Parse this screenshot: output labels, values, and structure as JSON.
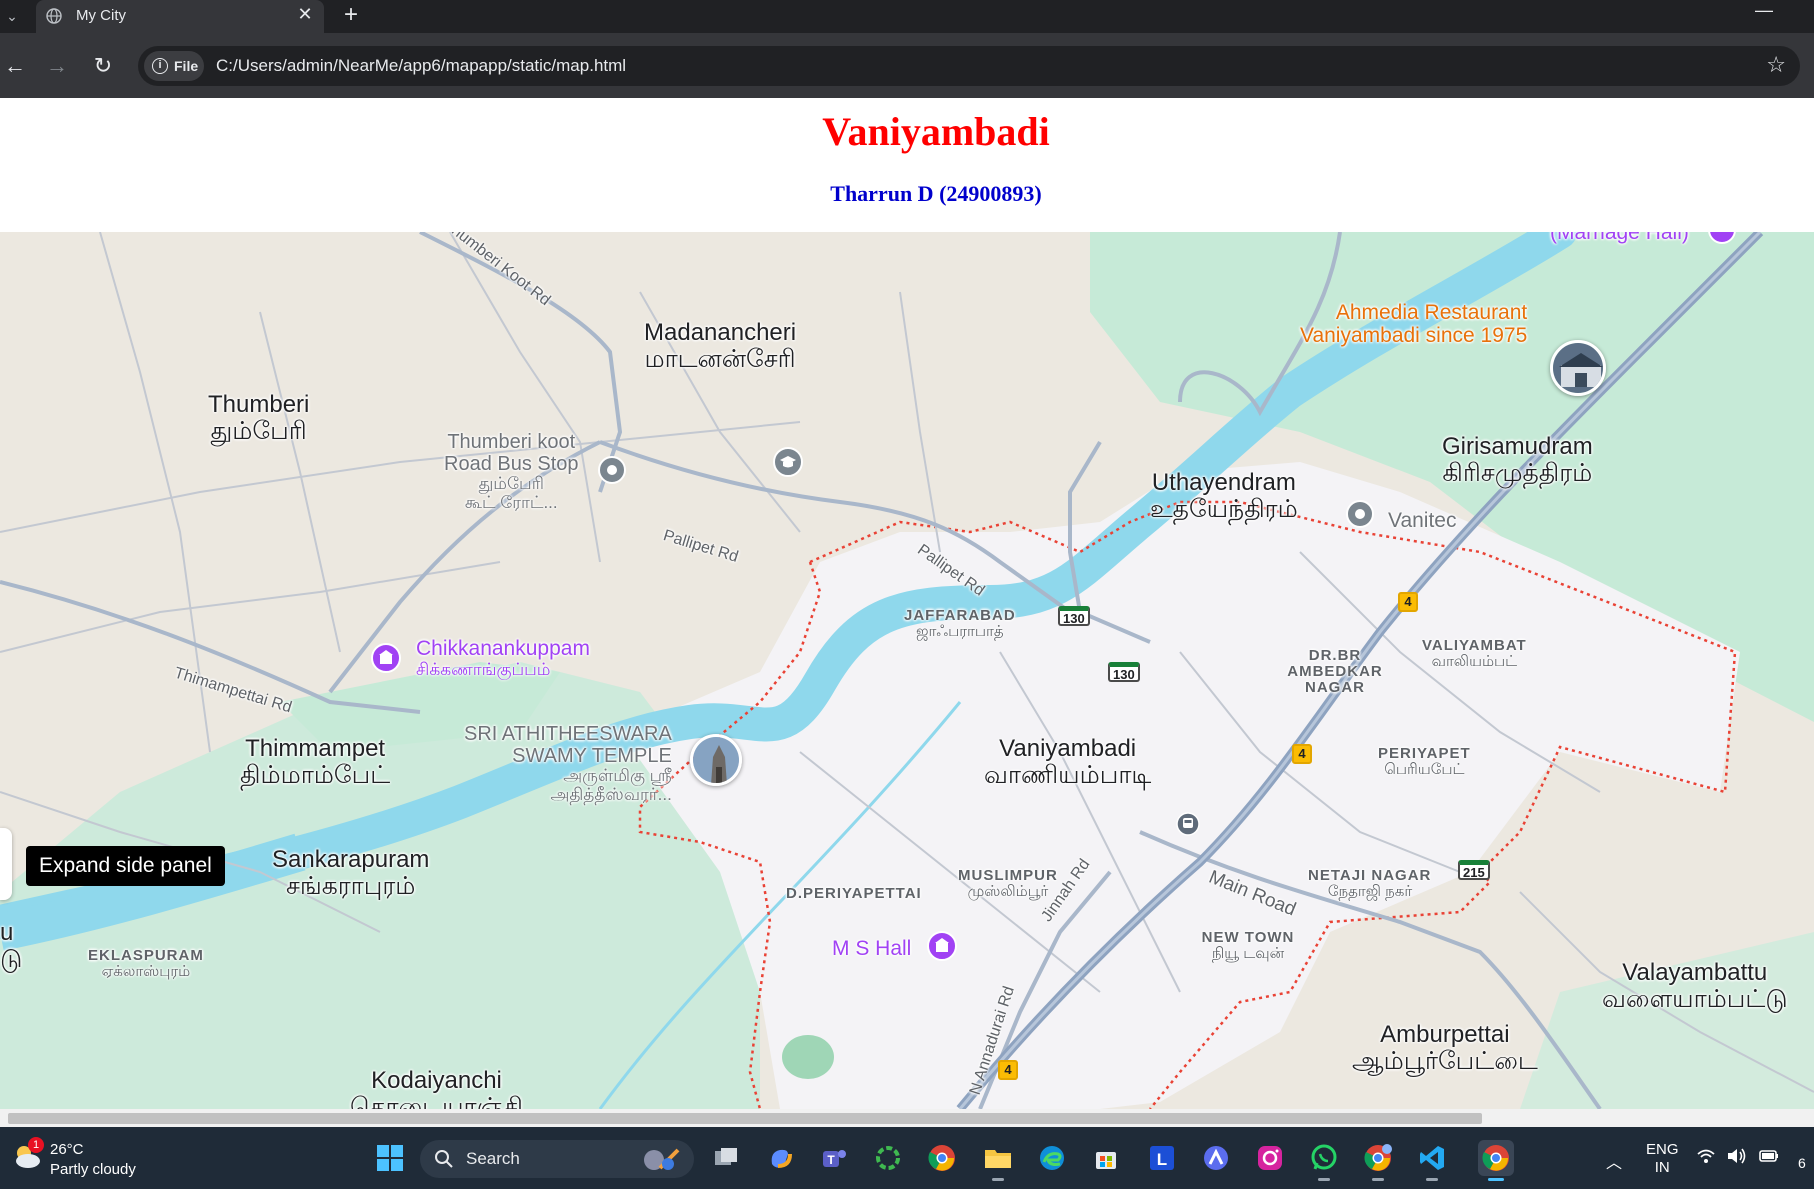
{
  "browser": {
    "tab_title": "My City",
    "new_tab": "+",
    "close_tab": "✕",
    "minimize": "—",
    "chip_label": "File",
    "url": "C:/Users/admin/NearMe/app6/mapapp/static/map.html"
  },
  "page": {
    "title": "Vaniyambadi",
    "subtitle": "Tharrun D (24900893)"
  },
  "map": {
    "towns": {
      "madanancheri": {
        "en": "Madanancheri",
        "ta": "மாடனன்சேரி"
      },
      "thumberi": {
        "en": "Thumberi",
        "ta": "தும்பேரி"
      },
      "uthayendram": {
        "en": "Uthayendram",
        "ta": "உதயேந்திரம்"
      },
      "girisamudram": {
        "en": "Girisamudram",
        "ta": "கிரிசமுத்திரம்"
      },
      "thimmampet": {
        "en": "Thimmampet",
        "ta": "திம்மாம்பேட்"
      },
      "vaniyambadi": {
        "en": "Vaniyambadi",
        "ta": "வாணியம்பாடி"
      },
      "sankarapuram": {
        "en": "Sankarapuram",
        "ta": "சங்கராபுரம்"
      },
      "valayambattu": {
        "en": "Valayambattu",
        "ta": "வளையாம்பட்டு"
      },
      "amburpettai": {
        "en": "Amburpettai",
        "ta": "ஆம்பூர்பேட்டை"
      },
      "kodaiyanchi": {
        "en": "Kodaiyanchi",
        "ta": "கொடையாஞ்சி"
      },
      "edge_left": {
        "en": "u",
        "ta": "டு"
      }
    },
    "neighbourhoods": {
      "jaffarabad": {
        "en": "JAFFARABAD",
        "ta": "ஜாஃபராபாத்"
      },
      "drbr": {
        "en": "DR.BR AMBEDKAR NAGAR"
      },
      "valiyambat": {
        "en": "VALIYAMBAT",
        "ta": "வாலியம்பட்"
      },
      "periyapet": {
        "en": "PERIYAPET",
        "ta": "பெரியபேட்"
      },
      "netaji": {
        "en": "NETAJI NAGAR",
        "ta": "நேதாஜி நகர்"
      },
      "newtown": {
        "en": "NEW TOWN",
        "ta": "நியூ டவுன்"
      },
      "muslimpur": {
        "en": "MUSLIMPUR",
        "ta": "முஸ்லிம்பூர்"
      },
      "dperiyapettai": {
        "en": "D.PERIYAPETTAI"
      },
      "eklaspuram": {
        "en": "EKLASPURAM",
        "ta": "ஏக்லாஸ்புரம்"
      }
    },
    "pois": {
      "marriage_hall": "(Marriage Hall)",
      "ahmedia_line1": "Ahmedia Restaurant",
      "ahmedia_line2": "Vaniyambadi since 1975",
      "bus_stop_line1": "Thumberi koot",
      "bus_stop_line2": "Road Bus Stop",
      "bus_stop_ta1": "தும்பேரி",
      "bus_stop_ta2": "கூட் ரோட்...",
      "vanitec": "Vanitec",
      "chikkanankuppam": "Chikkanankuppam",
      "chikkanankuppam_ta": "சிக்கணாங்குப்பம்",
      "temple_line1": "SRI ATHITHEESWARA",
      "temple_line2": "SWAMY TEMPLE",
      "temple_ta1": "அருள்மிகு ஸ்ரீ",
      "temple_ta2": "அதித்தீஸ்வரர்...",
      "ms_hall": "M S Hall"
    },
    "roads": {
      "thumberi_koot": "Thumberi Koot Rd",
      "pallipet1": "Pallipet Rd",
      "pallipet2": "Pallipet Rd",
      "thimampettai": "Thimampettai Rd",
      "main_road": "Main Road",
      "jinnah": "Jinnah Rd",
      "annadurai": "N Annadurai Rd"
    },
    "shields": {
      "h130a": "130",
      "h130b": "130",
      "h215": "215",
      "n4a": "4",
      "n4b": "4",
      "n4c": "4"
    },
    "tooltip": "Expand side panel",
    "colors": {
      "water": "#8fd8ec",
      "park": "#c6ead7",
      "urban": "#f4f3f6",
      "boundary": "#e94235",
      "highway": "#8ea3c0"
    }
  },
  "taskbar": {
    "weather_badge": "1",
    "temperature": "26°C",
    "weather": "Partly cloudy",
    "search_label": "Search",
    "lang_line1": "ENG",
    "lang_line2": "IN",
    "clock_fragment": "6"
  }
}
